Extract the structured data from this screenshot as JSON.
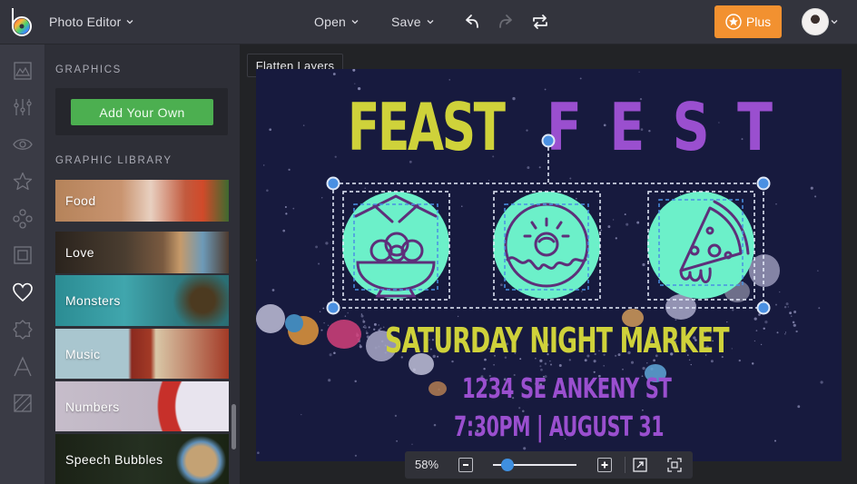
{
  "header": {
    "app_menu_label": "Photo Editor",
    "open_label": "Open",
    "save_label": "Save",
    "undo_icon": "undo-icon",
    "redo_icon": "redo-icon",
    "history_icon": "swap-icon",
    "plus_label": "Plus",
    "accent_color": "#f29130"
  },
  "rail": {
    "items": [
      {
        "name": "image-icon"
      },
      {
        "name": "adjust-sliders-icon"
      },
      {
        "name": "eye-icon"
      },
      {
        "name": "star-icon"
      },
      {
        "name": "overlays-icon"
      },
      {
        "name": "frames-icon"
      },
      {
        "name": "heart-icon",
        "active": true
      },
      {
        "name": "badge-icon"
      },
      {
        "name": "text-icon"
      },
      {
        "name": "textures-icon"
      }
    ]
  },
  "panel": {
    "graphics_heading": "GRAPHICS",
    "add_own_label": "Add Your Own",
    "library_heading": "GRAPHIC LIBRARY",
    "library": [
      {
        "label": "Food"
      },
      {
        "label": "Love"
      },
      {
        "label": "Monsters"
      },
      {
        "label": "Music"
      },
      {
        "label": "Numbers"
      },
      {
        "label": "Speech Bubbles"
      }
    ]
  },
  "workspace": {
    "flatten_label": "Flatten Layers",
    "poster": {
      "title_word_1": "FEAST",
      "title_word_2": "F E S T",
      "subtitle": "SATURDAY NIGHT MARKET",
      "address": "1234 SE ANKENY ST",
      "time_date": "7:30PM | AUGUST 31",
      "icons": [
        "noodle-bowl-icon",
        "donut-icon",
        "pizza-slice-icon"
      ],
      "colors": {
        "background": "#171a3e",
        "yellow": "#cfd23a",
        "purple": "#9a4fcf",
        "mint": "#6cf0c9",
        "selection": "#4a90e2"
      }
    },
    "zoom": {
      "value_label": "58%",
      "level_percent": 58
    }
  }
}
